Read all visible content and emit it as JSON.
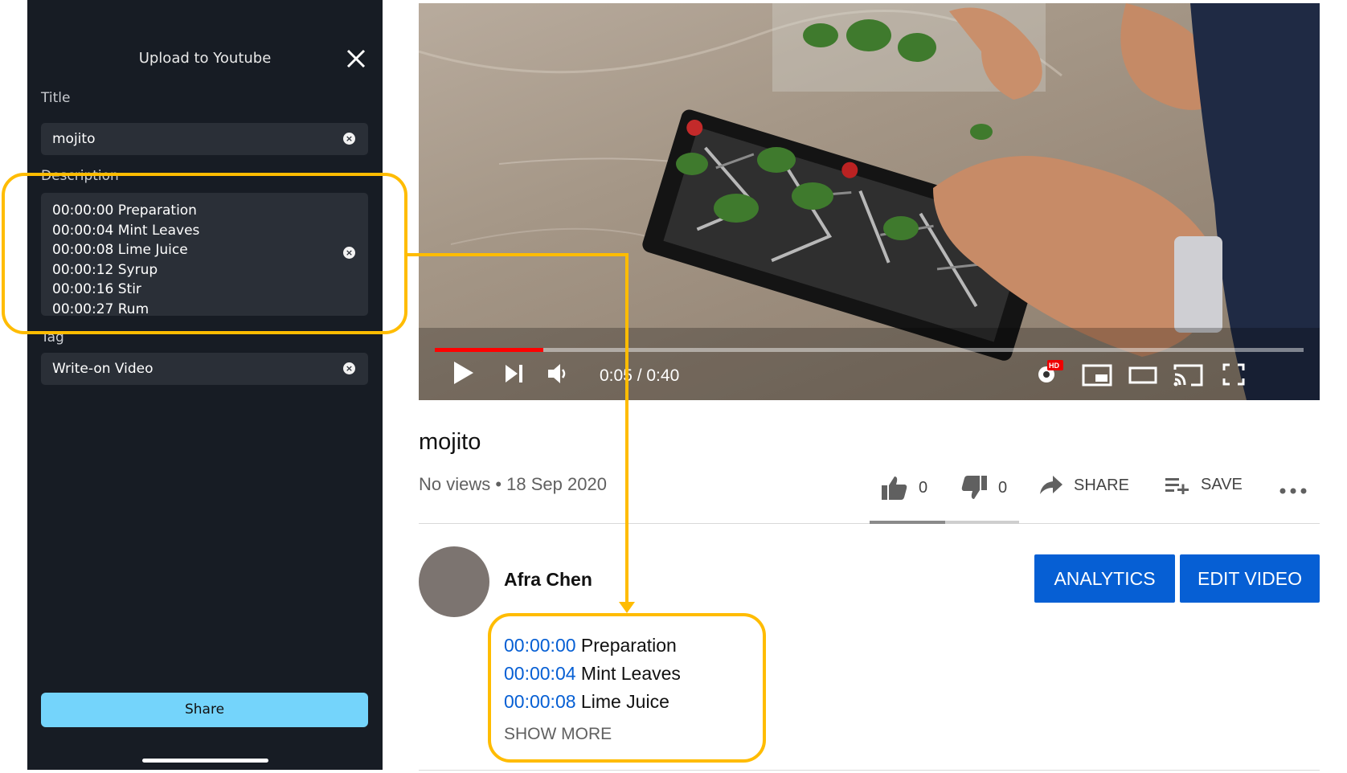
{
  "panel": {
    "title": "Upload to Youtube",
    "title_label": "Title",
    "title_value": "mojito",
    "description_label": "Description",
    "description_lines": [
      "00:00:00 Preparation",
      "00:00:04 Mint Leaves",
      "00:00:08 Lime Juice",
      "00:00:12 Syrup",
      "00:00:16 Stir",
      "00:00:27 Rum"
    ],
    "tag_label": "Tag",
    "tag_value": "Write-on Video",
    "share_label": "Share",
    "clear_glyph": "×",
    "close_icon": "close-icon"
  },
  "video": {
    "time": "0:05 / 0:40",
    "progress_fraction": 0.125,
    "hd_badge": "HD",
    "progress_color": "#ff0000"
  },
  "meta": {
    "title": "mojito",
    "stats": "No views • 18 Sep 2020",
    "like_count": "0",
    "dislike_count": "0",
    "share_label": "SHARE",
    "save_label": "SAVE"
  },
  "channel": {
    "name": "Afra Chen",
    "analytics_label": "ANALYTICS",
    "edit_label": "EDIT VIDEO",
    "accent": "#065fd4"
  },
  "description": {
    "lines": [
      {
        "time": "00:00:00",
        "text": " Preparation"
      },
      {
        "time": "00:00:04",
        "text": " Mint Leaves"
      },
      {
        "time": "00:00:08",
        "text": " Lime Juice"
      }
    ],
    "show_more": "SHOW MORE"
  },
  "annotation": {
    "color": "#ffbc00"
  }
}
